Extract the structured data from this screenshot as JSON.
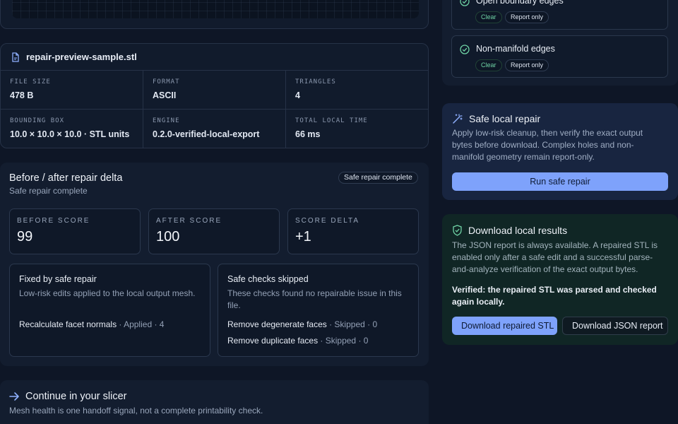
{
  "file": {
    "name": "repair-preview-sample.stl",
    "meta": [
      {
        "label": "FILE SIZE",
        "value": "478 B"
      },
      {
        "label": "FORMAT",
        "value": "ASCII"
      },
      {
        "label": "TRIANGLES",
        "value": "4"
      },
      {
        "label": "BOUNDING BOX",
        "value": "10.0 × 10.0 × 10.0 · STL units"
      },
      {
        "label": "ENGINE",
        "value": "0.2.0-verified-local-export"
      },
      {
        "label": "TOTAL LOCAL TIME",
        "value": "66 ms"
      }
    ]
  },
  "delta": {
    "title": "Before / after repair delta",
    "subtitle": "Safe repair complete",
    "badge": "Safe repair complete",
    "scores": [
      {
        "label": "BEFORE SCORE",
        "value": "99"
      },
      {
        "label": "AFTER SCORE",
        "value": "100"
      },
      {
        "label": "SCORE DELTA",
        "value": "+1"
      }
    ],
    "fixed": {
      "title": "Fixed by safe repair",
      "description": "Low-risk edits applied to the local output mesh.",
      "rows": [
        {
          "name": "Recalculate facet normals",
          "status": " · Applied · 4"
        }
      ]
    },
    "skipped": {
      "title": "Safe checks skipped",
      "description": "These checks found no repairable issue in this file.",
      "rows": [
        {
          "name": "Remove degenerate faces",
          "status": " · Skipped · 0"
        },
        {
          "name": "Remove duplicate faces",
          "status": " · Skipped · 0"
        }
      ]
    }
  },
  "slicer": {
    "title": "Continue in your slicer",
    "subtitle": "Mesh health is one handoff signal, not a complete printability check."
  },
  "checks": [
    {
      "title": "Open boundary edges",
      "clear": "Clear",
      "report": "Report only"
    },
    {
      "title": "Non-manifold edges",
      "clear": "Clear",
      "report": "Report only"
    }
  ],
  "repair_action": {
    "title": "Safe local repair",
    "description": "Apply low-risk cleanup, then verify the exact output bytes before download. Complex holes and non-manifold geometry remain report-only.",
    "button": "Run safe repair"
  },
  "download": {
    "title": "Download local results",
    "description": "The JSON report is always available. A repaired STL is enabled only after a safe edit and a successful parse-and-analyze verification of the exact output bytes.",
    "verified": "Verified: the repaired STL was parsed and checked again locally.",
    "stl_button": "Download repaired STL",
    "json_button": "Download JSON report"
  },
  "colors": {
    "accent": "#7ea2fb",
    "success": "#6fd3a5",
    "background": "#0e1626"
  }
}
